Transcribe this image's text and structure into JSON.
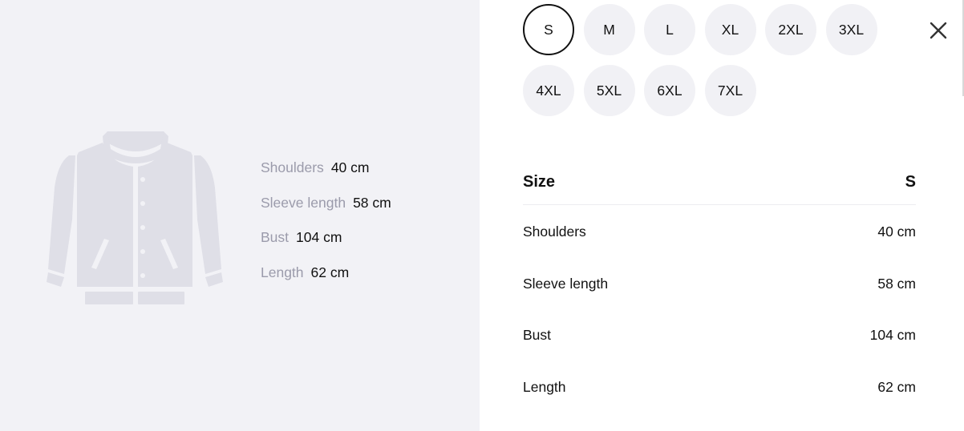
{
  "colors": {
    "panel_bg": "#f2f2f6",
    "chip_bg": "#f1f1f5",
    "muted_text": "#9b9bab",
    "text": "#111111",
    "divider": "#ececf0"
  },
  "illustration": {
    "icon": "jacket-icon"
  },
  "left_measurements": [
    {
      "label": "Shoulders",
      "value": "40 cm"
    },
    {
      "label": "Sleeve length",
      "value": "58 cm"
    },
    {
      "label": "Bust",
      "value": "104 cm"
    },
    {
      "label": "Length",
      "value": "62 cm"
    }
  ],
  "sizes": {
    "selected": "S",
    "options": [
      "S",
      "M",
      "L",
      "XL",
      "2XL",
      "3XL",
      "4XL",
      "5XL",
      "6XL",
      "7XL"
    ]
  },
  "close": {
    "icon": "close-icon"
  },
  "table": {
    "header_label": "Size",
    "header_value": "S",
    "rows": [
      {
        "label": "Shoulders",
        "value": "40 cm"
      },
      {
        "label": "Sleeve length",
        "value": "58 cm"
      },
      {
        "label": "Bust",
        "value": "104 cm"
      },
      {
        "label": "Length",
        "value": "62 cm"
      }
    ]
  }
}
